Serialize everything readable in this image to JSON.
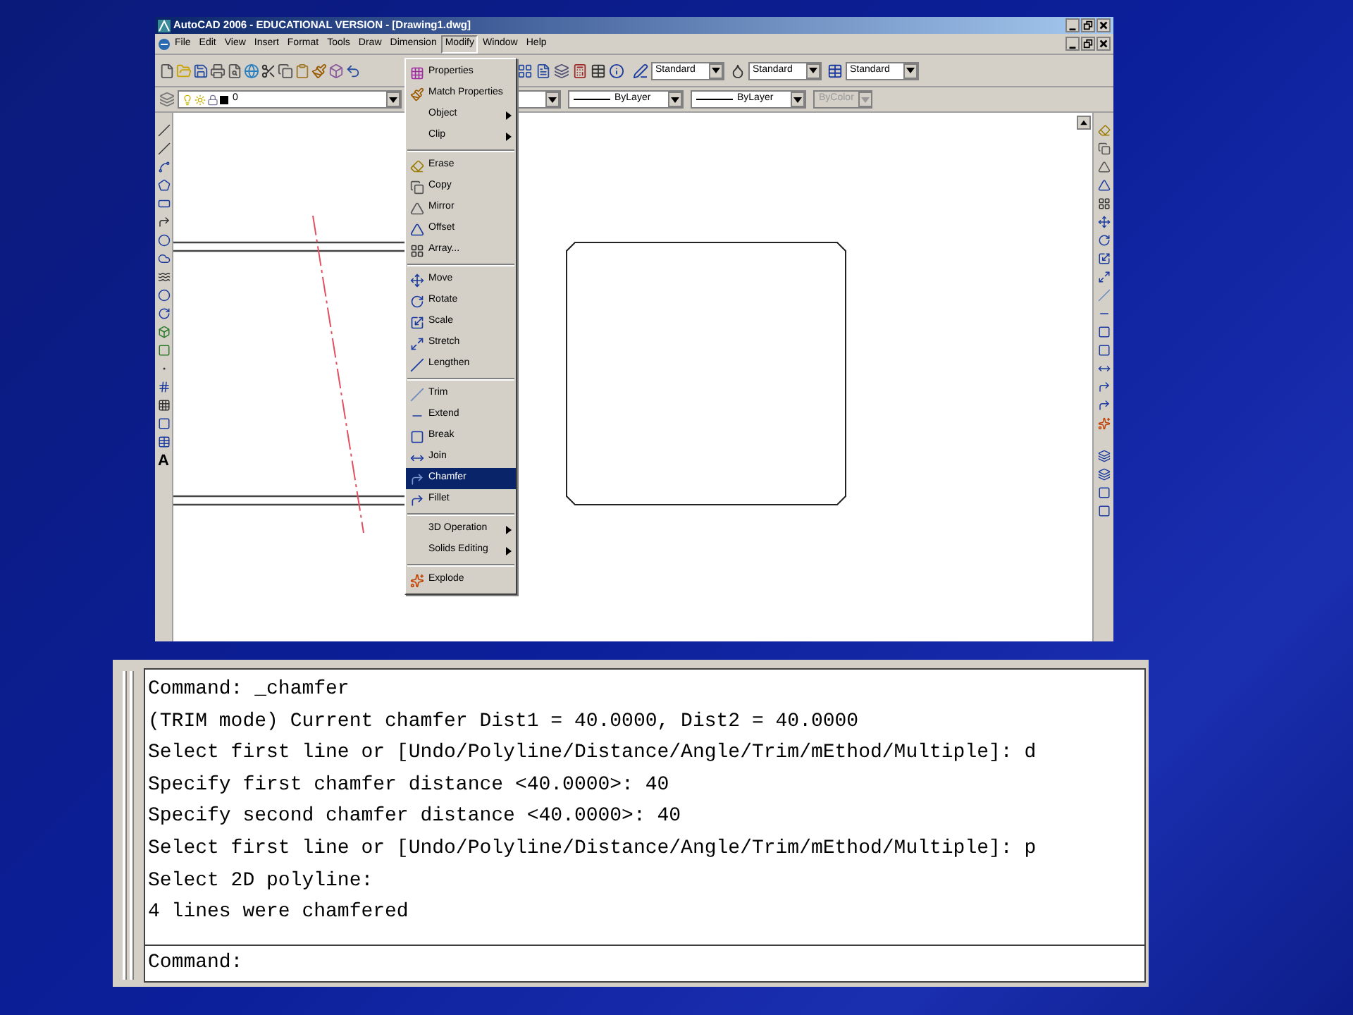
{
  "window": {
    "title": "AutoCAD 2006 - EDUCATIONAL VERSION - [Drawing1.dwg]"
  },
  "menu_bar": [
    {
      "label": "File",
      "selected": false
    },
    {
      "label": "Edit",
      "selected": false
    },
    {
      "label": "View",
      "selected": false
    },
    {
      "label": "Insert",
      "selected": false
    },
    {
      "label": "Format",
      "selected": false
    },
    {
      "label": "Tools",
      "selected": false
    },
    {
      "label": "Draw",
      "selected": false
    },
    {
      "label": "Dimension",
      "selected": false
    },
    {
      "label": "Modify",
      "selected": true
    },
    {
      "label": "Window",
      "selected": false
    },
    {
      "label": "Help",
      "selected": false
    }
  ],
  "style_combos": [
    {
      "value": "Standard"
    },
    {
      "value": "Standard"
    },
    {
      "value": "Standard"
    }
  ],
  "layer_combo": {
    "value": "0"
  },
  "property_combos": [
    {
      "value": "ByLayer",
      "disabled": false
    },
    {
      "value": "ByLayer",
      "disabled": false
    },
    {
      "value": "ByColor",
      "disabled": true
    }
  ],
  "draw_toolbar": {
    "text_tool": "A"
  },
  "modify_menu": [
    {
      "kind": "item",
      "label": "Properties",
      "selected": false,
      "submenu": false
    },
    {
      "kind": "item",
      "label": "Match Properties",
      "selected": false,
      "submenu": false
    },
    {
      "kind": "item",
      "label": "Object",
      "selected": false,
      "submenu": true
    },
    {
      "kind": "item",
      "label": "Clip",
      "selected": false,
      "submenu": true
    },
    {
      "kind": "separator"
    },
    {
      "kind": "item",
      "label": "Erase",
      "selected": false,
      "submenu": false
    },
    {
      "kind": "item",
      "label": "Copy",
      "selected": false,
      "submenu": false
    },
    {
      "kind": "item",
      "label": "Mirror",
      "selected": false,
      "submenu": false
    },
    {
      "kind": "item",
      "label": "Offset",
      "selected": false,
      "submenu": false
    },
    {
      "kind": "item",
      "label": "Array...",
      "selected": false,
      "submenu": false
    },
    {
      "kind": "separator"
    },
    {
      "kind": "item",
      "label": "Move",
      "selected": false,
      "submenu": false
    },
    {
      "kind": "item",
      "label": "Rotate",
      "selected": false,
      "submenu": false
    },
    {
      "kind": "item",
      "label": "Scale",
      "selected": false,
      "submenu": false
    },
    {
      "kind": "item",
      "label": "Stretch",
      "selected": false,
      "submenu": false
    },
    {
      "kind": "item",
      "label": "Lengthen",
      "selected": false,
      "submenu": false
    },
    {
      "kind": "separator"
    },
    {
      "kind": "item",
      "label": "Trim",
      "selected": false,
      "submenu": false
    },
    {
      "kind": "item",
      "label": "Extend",
      "selected": false,
      "submenu": false
    },
    {
      "kind": "item",
      "label": "Break",
      "selected": false,
      "submenu": false
    },
    {
      "kind": "item",
      "label": "Join",
      "selected": false,
      "submenu": false
    },
    {
      "kind": "item",
      "label": "Chamfer",
      "selected": true,
      "submenu": false
    },
    {
      "kind": "item",
      "label": "Fillet",
      "selected": false,
      "submenu": false
    },
    {
      "kind": "separator"
    },
    {
      "kind": "item",
      "label": "3D Operation",
      "selected": false,
      "submenu": true
    },
    {
      "kind": "item",
      "label": "Solids Editing",
      "selected": false,
      "submenu": true
    },
    {
      "kind": "separator"
    },
    {
      "kind": "item",
      "label": "Explode",
      "selected": false,
      "submenu": false
    }
  ],
  "command_history": [
    "Command: _chamfer",
    "(TRIM mode) Current chamfer Dist1 = 40.0000, Dist2 = 40.0000",
    "Select first line or [Undo/Polyline/Distance/Angle/Trim/mEthod/Multiple]: d",
    "Specify first chamfer distance <40.0000>: 40",
    "Specify second chamfer distance <40.0000>: 40",
    "Select first line or [Undo/Polyline/Distance/Angle/Trim/mEthod/Multiple]: p",
    "Select 2D polyline:",
    "4 lines were chamfered"
  ],
  "command_prompt": "Command:"
}
